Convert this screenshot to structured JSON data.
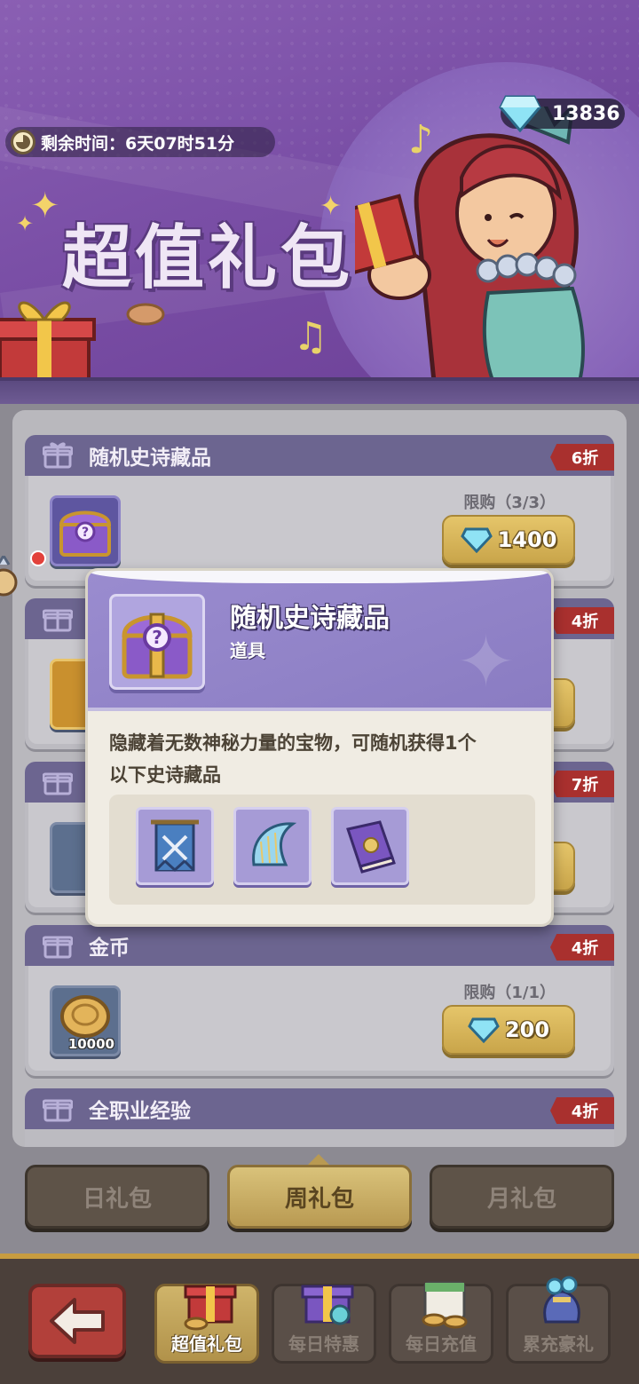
{
  "banner": {
    "title": "超值礼包",
    "timer_label": "剩余时间：6天07时51分",
    "gems": "13836"
  },
  "list": {
    "cards": [
      {
        "title": "随机史诗藏品",
        "discount": "6折",
        "limit": "限购（3/3）",
        "price": "1400"
      },
      {
        "title": "",
        "discount": "4折"
      },
      {
        "title": "",
        "discount": "7折"
      },
      {
        "title": "金币",
        "discount": "4折",
        "limit": "限购（1/1）",
        "price": "200",
        "qty": "10000"
      },
      {
        "title": "全职业经验",
        "discount": "4折"
      }
    ]
  },
  "popup": {
    "title": "随机史诗藏品",
    "subtitle": "道具",
    "description_line1": "隐藏着无数神秘力量的宝物，可随机获得1个",
    "description_line2": "以下史诗藏品",
    "rewards": [
      "banner-icon",
      "harp-icon",
      "book-icon"
    ]
  },
  "tabs": {
    "daily": "日礼包",
    "weekly": "周礼包",
    "monthly": "月礼包"
  },
  "nav": {
    "value_pack": "超值礼包",
    "daily_deal": "每日特惠",
    "daily_recharge": "每日充值",
    "cumulative": "累充豪礼"
  },
  "colors": {
    "banner_purple": "#7a4fa6",
    "discount_red": "#a9302e",
    "gold": "#c9a54a",
    "header_violet": "#6c6590"
  }
}
